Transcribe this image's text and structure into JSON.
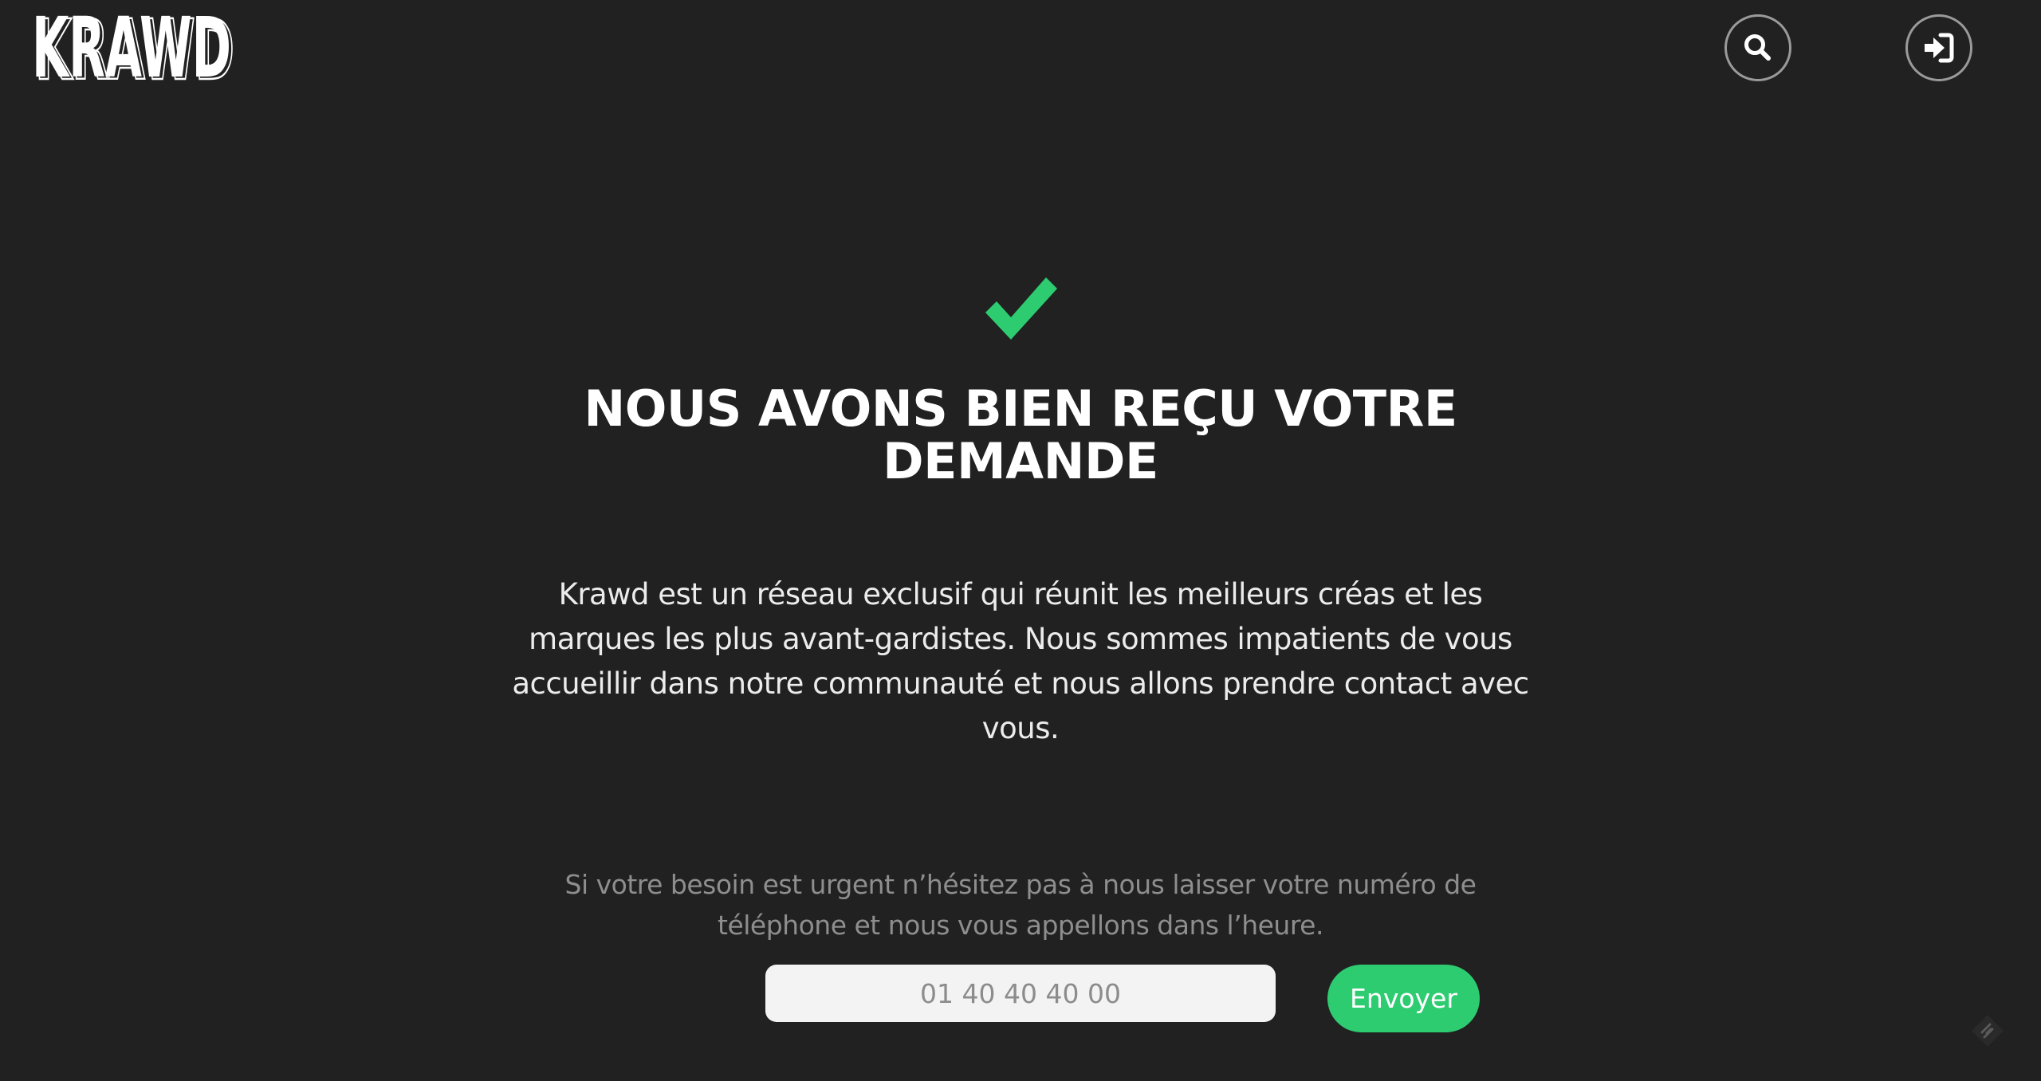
{
  "brand": {
    "logo_text": "KRAWD"
  },
  "header": {
    "search_icon": "search-icon",
    "login_icon": "sign-in-icon"
  },
  "confirmation": {
    "icon": "checkmark-icon",
    "icon_color": "#2ecc71",
    "title_line1": "NOUS AVONS BIEN REÇU VOTRE",
    "title_line2": "DEMANDE",
    "description": "Krawd est un réseau exclusif qui réunit les meilleurs créas et les marques les plus avant-gardistes. Nous sommes impatients de vous accueillir dans notre communauté et nous allons prendre contact avec vous."
  },
  "callback": {
    "message": "Si votre besoin est urgent n’hésitez pas à nous laisser votre numéro de téléphone et nous vous appellons dans l’heure.",
    "phone_placeholder": "01 40 40 40 00",
    "phone_value": "",
    "submit_label": "Envoyer",
    "accent_color": "#2ecc71"
  },
  "colors": {
    "background": "#212121",
    "text": "#ffffff",
    "muted_text": "#8e8e8e"
  }
}
